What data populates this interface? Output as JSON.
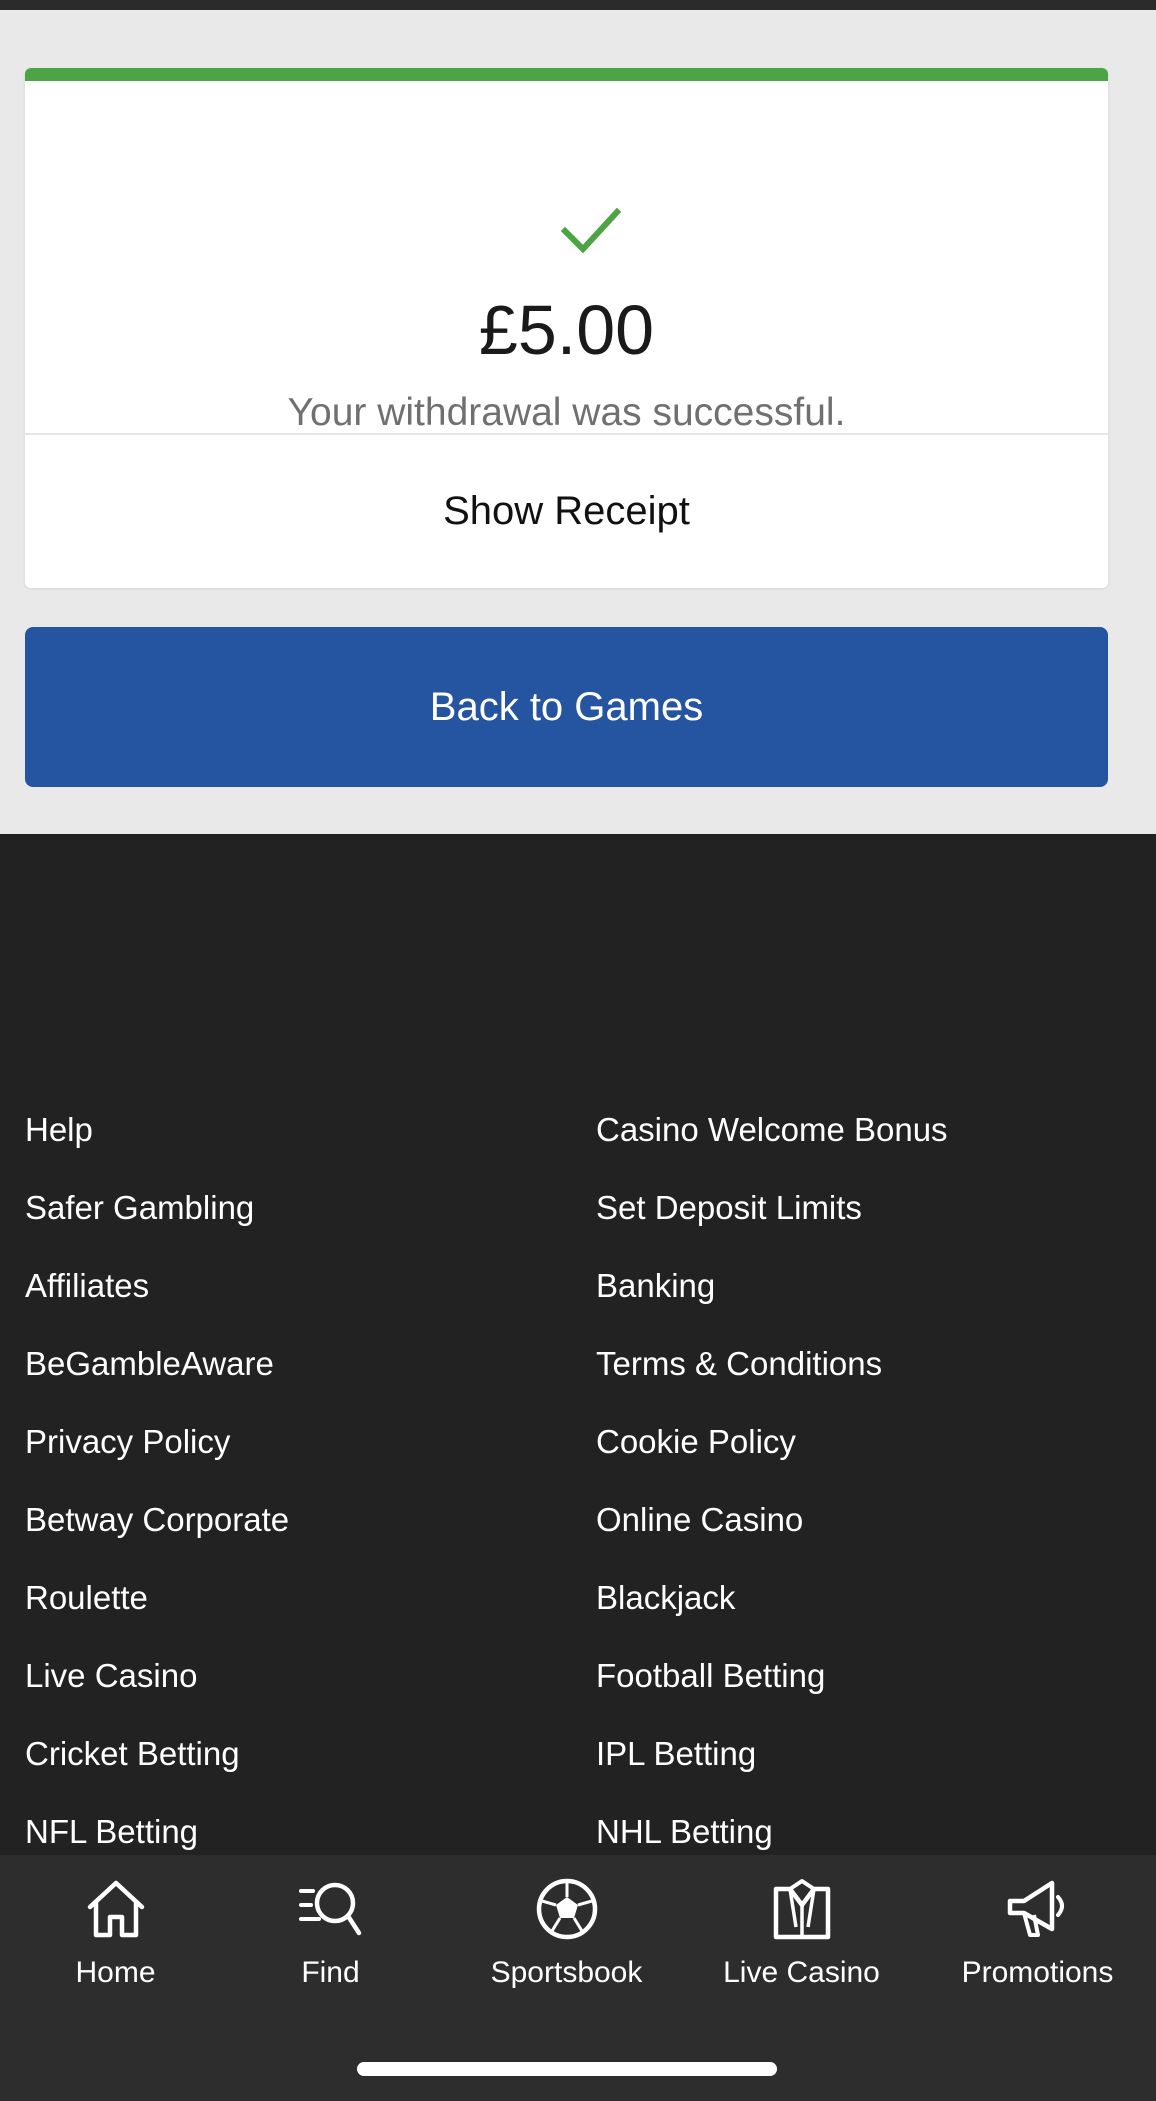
{
  "receipt": {
    "amount": "£5.00",
    "message": "Your withdrawal was successful.",
    "show_receipt_label": "Show Receipt",
    "back_label": "Back to Games",
    "accent_color": "#4ca444",
    "button_color": "#2554a1"
  },
  "footer": {
    "left_links": [
      "Help",
      "Safer Gambling",
      "Affiliates",
      "BeGambleAware",
      "Privacy Policy",
      "Betway Corporate",
      "Roulette",
      "Live Casino",
      "Cricket Betting",
      "NFL Betting"
    ],
    "right_links": [
      "Casino Welcome Bonus",
      "Set Deposit Limits",
      "Banking",
      "Terms & Conditions",
      "Cookie Policy",
      "Online Casino",
      "Blackjack",
      "Football Betting",
      "IPL Betting",
      "NHL Betting"
    ]
  },
  "nav": {
    "items": [
      {
        "label": "Home",
        "icon": "home-icon"
      },
      {
        "label": "Find",
        "icon": "search-icon"
      },
      {
        "label": "Sportsbook",
        "icon": "football-icon"
      },
      {
        "label": "Live Casino",
        "icon": "dealer-icon"
      },
      {
        "label": "Promotions",
        "icon": "megaphone-icon"
      }
    ]
  }
}
